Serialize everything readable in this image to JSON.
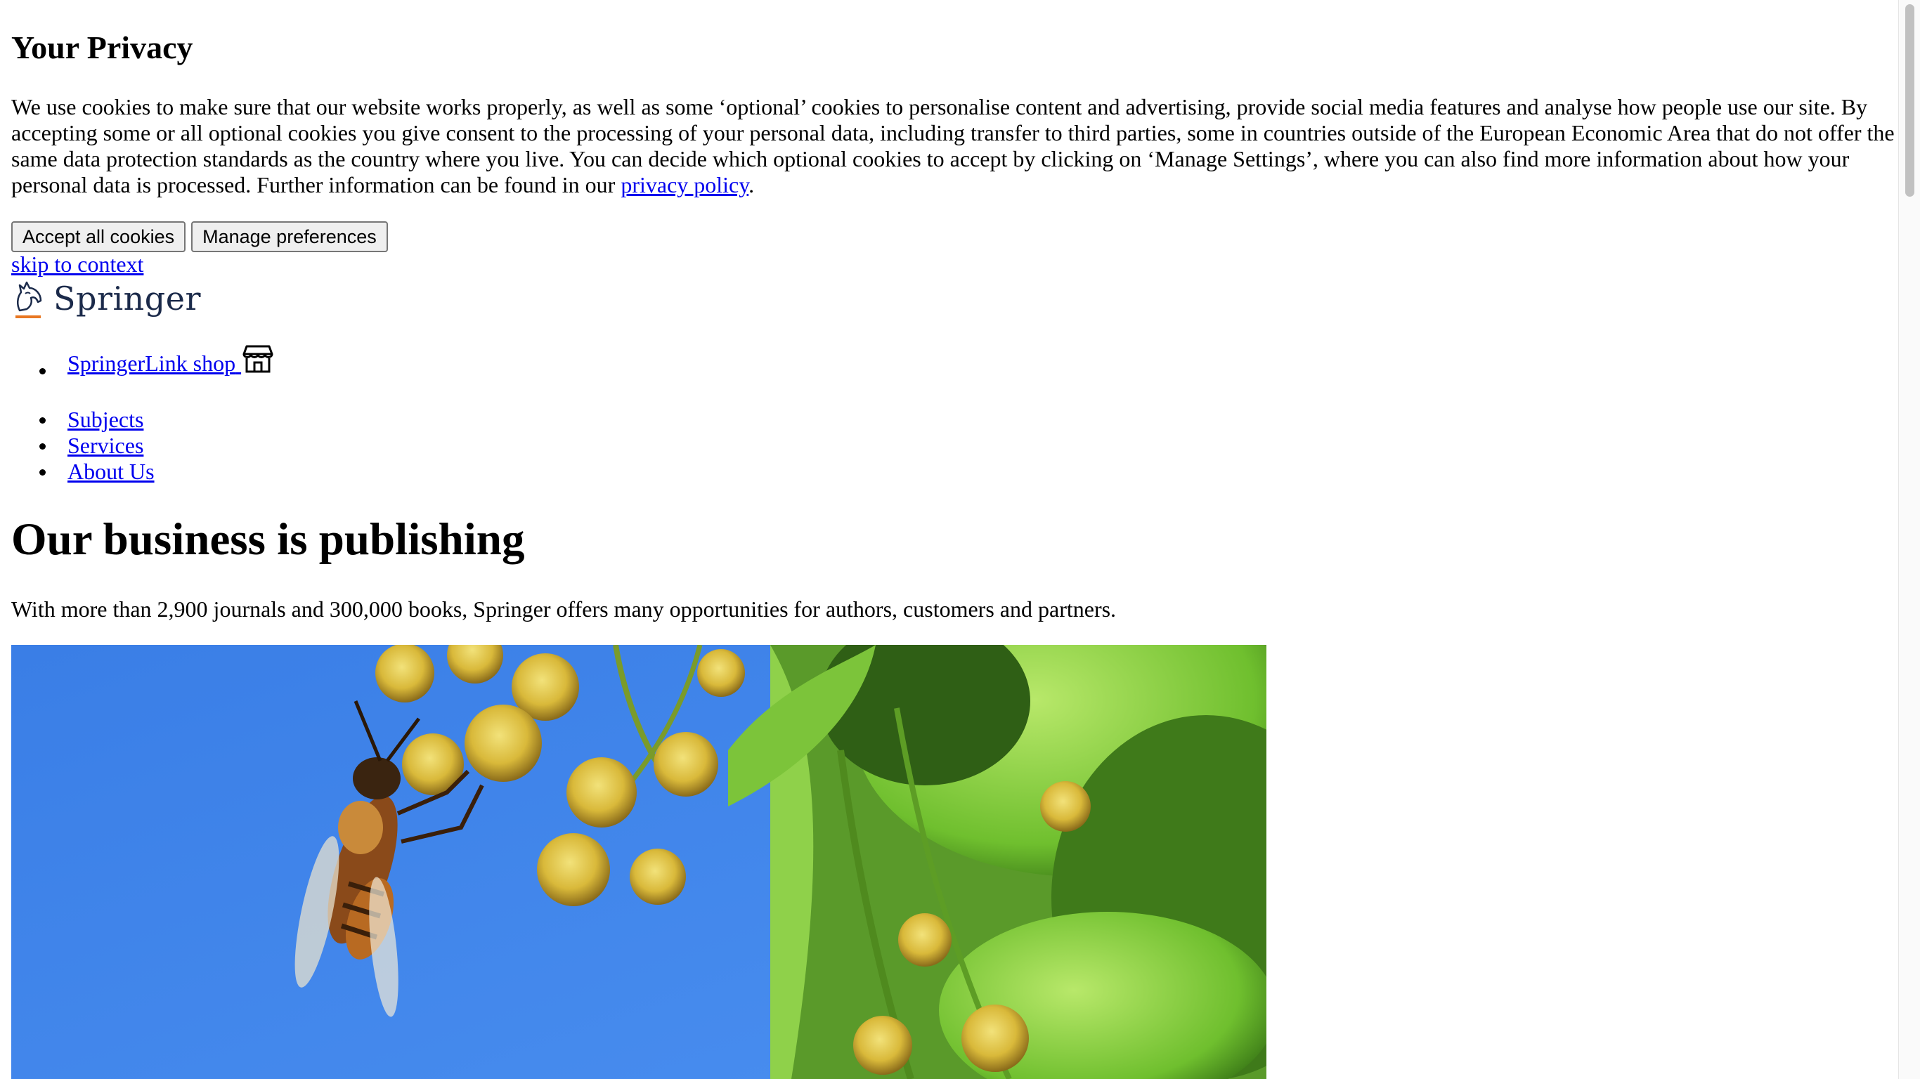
{
  "cookie_banner": {
    "title": "Your Privacy",
    "body_text": "We use cookies to make sure that our website works properly, as well as some ‘optional’ cookies to personalise content and advertising, provide social media features and analyse how people use our site. By accepting some or all optional cookies you give consent to the processing of your personal data, including transfer to third parties, some in countries outside of the European Economic Area that do not offer the same data protection standards as the country where you live. You can decide which optional cookies to accept by clicking on ‘Manage Settings’, where you can also find more information about how your personal data is processed. Further information can be found in our",
    "privacy_link": "privacy policy",
    "trailing": ".",
    "accept_label": "Accept all cookies",
    "manage_label": "Manage preferences"
  },
  "skip_link": "skip to context",
  "logo": {
    "text": "Springer",
    "icon": "springer-horse-logo"
  },
  "shop": {
    "label": "SpringerLink shop",
    "icon": "storefront-icon"
  },
  "nav": {
    "items": [
      {
        "label": "Subjects"
      },
      {
        "label": "Services"
      },
      {
        "label": "About Us"
      }
    ]
  },
  "hero": {
    "title": "Our business is publishing",
    "text": "With more than 2,900 journals and 300,000 books, Springer offers many opportunities for authors, customers and partners."
  },
  "colors": {
    "link": "#0000ee",
    "logo_text": "#1b2a4a",
    "logo_accent": "#e87722",
    "sky": "#3f83e6"
  }
}
